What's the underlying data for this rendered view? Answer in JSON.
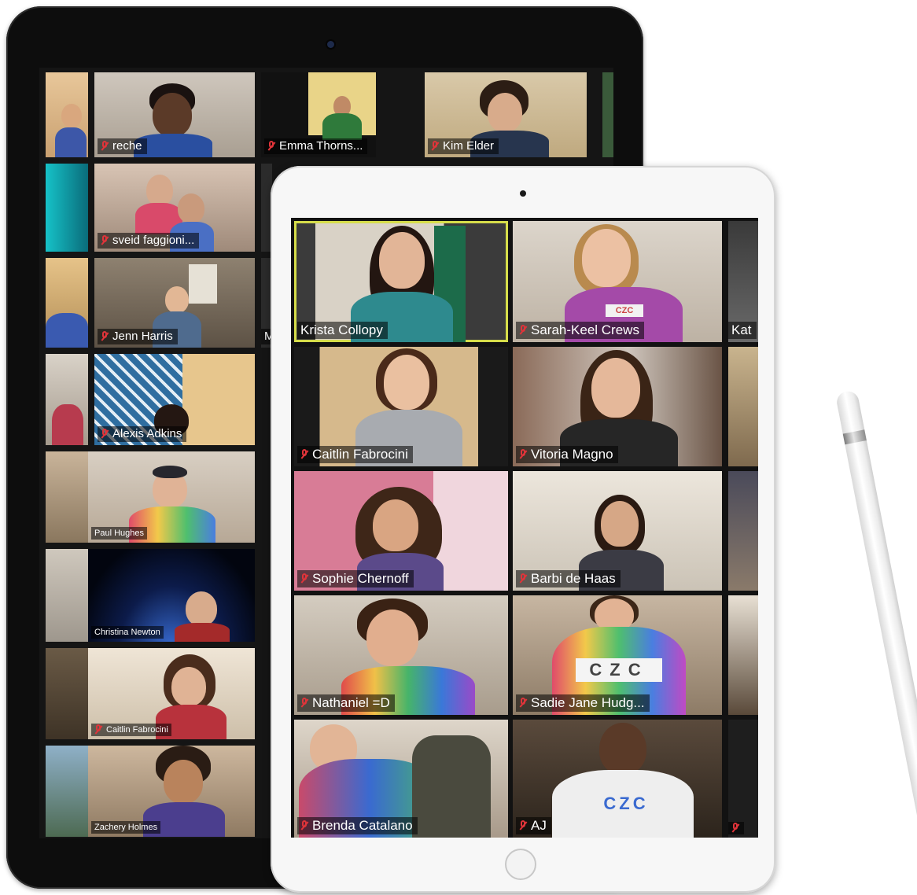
{
  "back_ipad": {
    "tiles": [
      {
        "name": "reche"
      },
      {
        "name": "Emma Thorns..."
      },
      {
        "name": "Kim Elder"
      },
      {
        "name": "sveid faggioni..."
      },
      {
        "name": "Jenn Harris"
      },
      {
        "name": "Alexis Adkins"
      },
      {
        "name": "Paul Hughes"
      },
      {
        "name": "Christina Newton"
      },
      {
        "name": "Caitlin Fabrocini"
      },
      {
        "name": "Zachery Holmes"
      }
    ],
    "partial_labels": [
      "M"
    ]
  },
  "front_ipad": {
    "tiles": [
      {
        "name": "Krista Collopy"
      },
      {
        "name": "Sarah-Keel Crews"
      },
      {
        "name": "Caitlin Fabrocini"
      },
      {
        "name": "Vitoria Magno"
      },
      {
        "name": "Sophie Chernoff"
      },
      {
        "name": "Barbi de Haas"
      },
      {
        "name": "Nathaniel =D"
      },
      {
        "name": "Sadie Jane Hudg..."
      },
      {
        "name": "Brenda Catalano"
      },
      {
        "name": "AJ"
      }
    ],
    "partial_labels": [
      "Kat"
    ],
    "shirt_text": "CZC"
  },
  "colors": {
    "active_speaker_border": "#d6dd4a",
    "muted_icon": "#e0343a",
    "back_ipad_frame": "#0d0d0d",
    "front_ipad_frame": "#f7f7f7"
  },
  "icons": [
    "muted-mic-icon",
    "camera-icon",
    "home-button-icon",
    "apple-pencil-icon"
  ]
}
